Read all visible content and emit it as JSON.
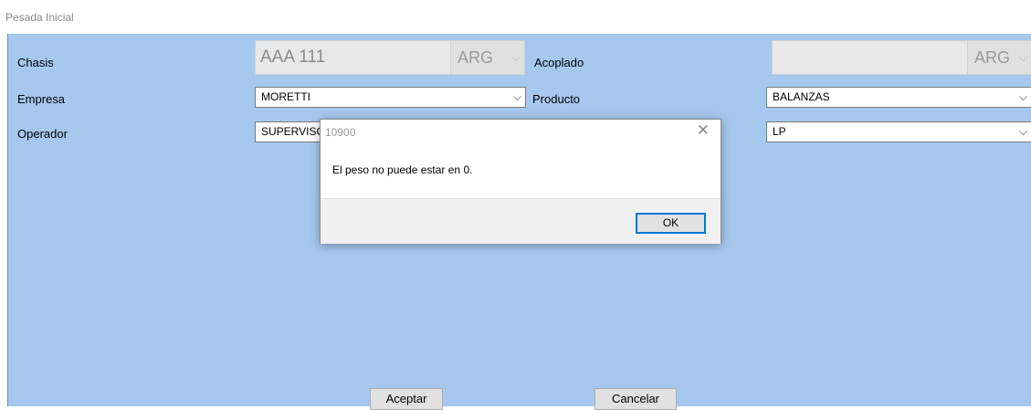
{
  "window": {
    "title": "Pesada Inicial"
  },
  "form": {
    "chasis_label": "Chasis",
    "chasis_value": "AAA 111",
    "chasis_country": "ARG",
    "acoplado_label": "Acoplado",
    "acoplado_value": "",
    "acoplado_country": "ARG",
    "empresa_label": "Empresa",
    "empresa_value": "MORETTI",
    "producto_label": "Producto",
    "producto_value": "BALANZAS",
    "operador_label": "Operador",
    "operador_value": "SUPERVISOR",
    "third_combo_value": "LP",
    "chevron": "⌵"
  },
  "buttons": {
    "aceptar": "Aceptar",
    "cancelar": "Cancelar"
  },
  "dialog": {
    "title": "10900",
    "close_glyph": "✕",
    "message": "El peso no puede estar en 0.",
    "ok_label": "OK"
  },
  "colors": {
    "panel_background": "#a6c8ee",
    "focus_border": "#0078d7"
  }
}
